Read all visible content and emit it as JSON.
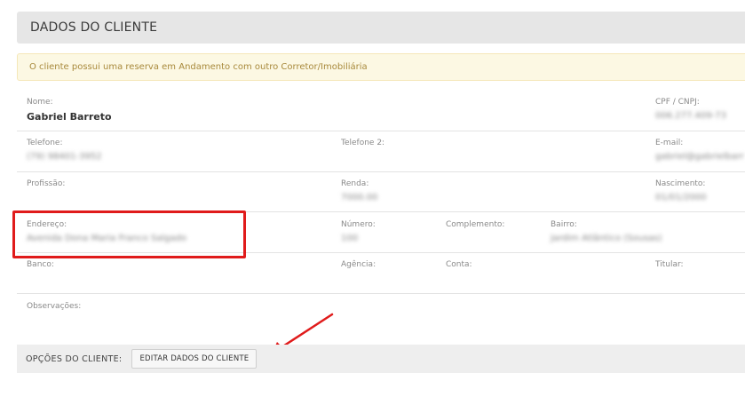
{
  "header": {
    "title": "DADOS DO CLIENTE"
  },
  "alert": {
    "text": "O cliente possui uma reserva em Andamento com outro Corretor/Imobiliária"
  },
  "fields": {
    "nome": {
      "label": "Nome:",
      "value": "Gabriel Barreto"
    },
    "cpf": {
      "label": "CPF / CNPJ:",
      "value": "006.277.409-73"
    },
    "telefone": {
      "label": "Telefone:",
      "value": "(79) 98401-3952"
    },
    "telefone2": {
      "label": "Telefone 2:",
      "value": ""
    },
    "email": {
      "label": "E-mail:",
      "value": "gabriel@gabrielbarr"
    },
    "profissao": {
      "label": "Profissão:",
      "value": ""
    },
    "renda": {
      "label": "Renda:",
      "value": "7000.00"
    },
    "nascimento": {
      "label": "Nascimento:",
      "value": "01/01/2000"
    },
    "endereco": {
      "label": "Endereço:",
      "value": "Avenida Dona Maria Franco Salgado"
    },
    "numero": {
      "label": "Número:",
      "value": "100"
    },
    "complemento": {
      "label": "Complemento:",
      "value": ""
    },
    "bairro": {
      "label": "Bairro:",
      "value": "Jardim Atlântico (Sousas)"
    },
    "banco": {
      "label": "Banco:",
      "value": ""
    },
    "agencia": {
      "label": "Agência:",
      "value": ""
    },
    "conta": {
      "label": "Conta:",
      "value": ""
    },
    "titular": {
      "label": "Titular:",
      "value": ""
    },
    "observacoes": {
      "label": "Observações:",
      "value": ""
    }
  },
  "options": {
    "label": "OPÇÕES DO CLIENTE:",
    "edit_button": "EDITAR DADOS DO CLIENTE"
  },
  "colors": {
    "highlight": "#e01b1b",
    "arrow": "#e01b1b"
  }
}
